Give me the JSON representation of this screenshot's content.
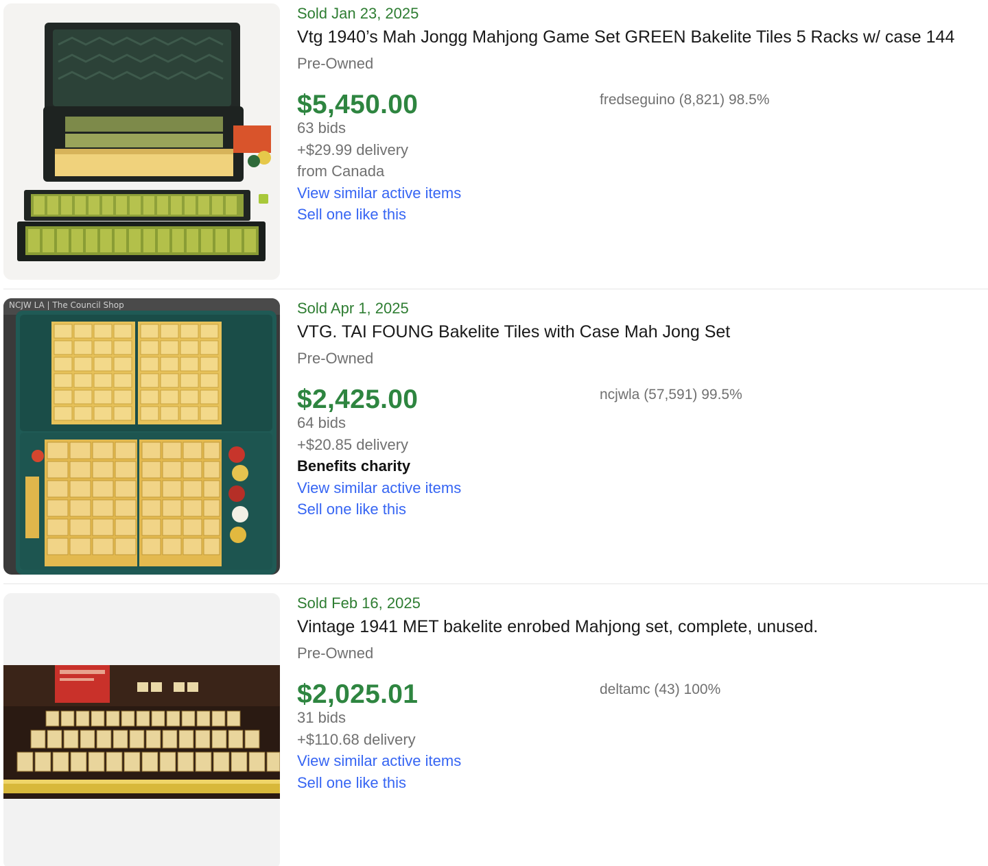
{
  "listings": [
    {
      "sold_date": "Sold Jan 23, 2025",
      "title": "Vtg 1940’s Mah Jongg Mahjong Game Set GREEN Bakelite Tiles 5 Racks w/ case 144",
      "condition": "Pre-Owned",
      "price": "$5,450.00",
      "seller": "fredseguino (8,821) 98.5%",
      "bids": "63 bids",
      "delivery": "+$29.99 delivery",
      "location": "from Canada",
      "view_similar": "View similar active items",
      "sell_one": "Sell one like this"
    },
    {
      "sold_date": "Sold Apr 1, 2025",
      "title": "VTG. TAI FOUNG Bakelite Tiles with Case Mah Jong Set",
      "condition": "Pre-Owned",
      "price": "$2,425.00",
      "seller": "ncjwla (57,591) 99.5%",
      "bids": "64 bids",
      "delivery": "+$20.85 delivery",
      "charity": "Benefits charity",
      "watermark": "NCJW LA | The Council Shop",
      "view_similar": "View similar active items",
      "sell_one": "Sell one like this"
    },
    {
      "sold_date": "Sold Feb 16, 2025",
      "title": "Vintage 1941 MET bakelite enrobed Mahjong set, complete, unused.",
      "condition": "Pre-Owned",
      "price": "$2,025.01",
      "seller": "deltamc (43) 100%",
      "bids": "31 bids",
      "delivery": "+$110.68 delivery",
      "view_similar": "View similar active items",
      "sell_one": "Sell one like this"
    }
  ],
  "colors": {
    "sold_green": "#2e7d32",
    "price_green": "#2e8540",
    "link_blue": "#3665f3",
    "muted_gray": "#707070"
  }
}
